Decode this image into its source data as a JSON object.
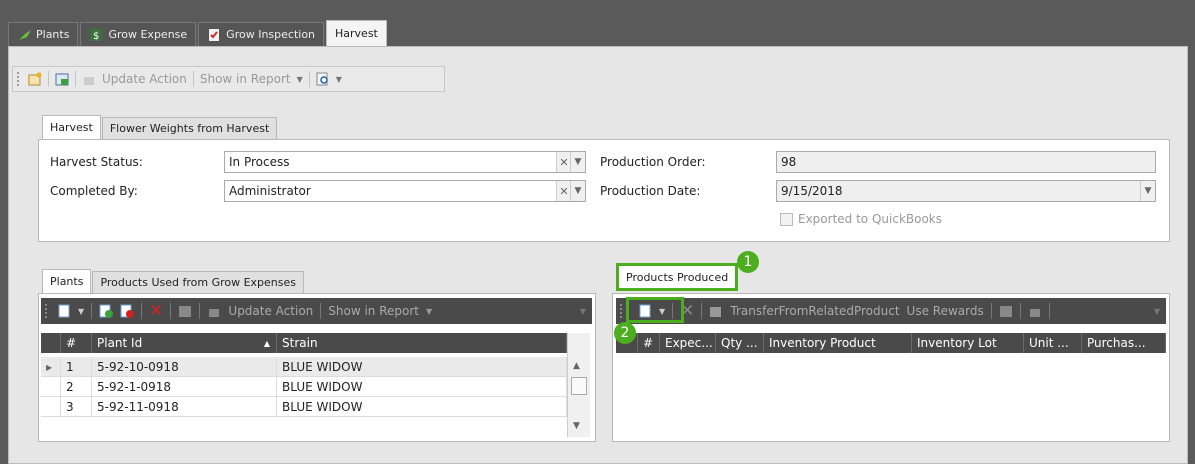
{
  "doc_tabs": [
    {
      "label": "Plants",
      "icon": "plant-icon"
    },
    {
      "label": "Grow Expense",
      "icon": "expense-icon"
    },
    {
      "label": "Grow Inspection",
      "icon": "inspection-icon"
    },
    {
      "label": "Harvest",
      "icon": ""
    }
  ],
  "main_toolbar": {
    "update_action": "Update Action",
    "show_in_report": "Show in Report"
  },
  "harvest_tabs": [
    "Harvest",
    "Flower Weights from Harvest"
  ],
  "form": {
    "harvest_status_label": "Harvest Status:",
    "harvest_status_value": "In Process",
    "completed_by_label": "Completed By:",
    "completed_by_value": "Administrator",
    "production_order_label": "Production Order:",
    "production_order_value": "98",
    "production_date_label": "Production Date:",
    "production_date_value": "9/15/2018",
    "exported_label": "Exported to QuickBooks"
  },
  "plants_tabs": [
    "Plants",
    "Products Used from Grow Expenses"
  ],
  "plants_toolbar": {
    "update_action": "Update Action",
    "show_in_report": "Show in Report"
  },
  "plants_grid": {
    "columns": [
      "#",
      "Plant Id",
      "Strain"
    ],
    "rows": [
      {
        "n": "1",
        "plant_id": "5-92-10-0918",
        "strain": "BLUE WIDOW"
      },
      {
        "n": "2",
        "plant_id": "5-92-1-0918",
        "strain": "BLUE WIDOW"
      },
      {
        "n": "3",
        "plant_id": "5-92-11-0918",
        "strain": "BLUE WIDOW"
      }
    ]
  },
  "products_tab": "Products Produced",
  "products_toolbar": {
    "transfer": "TransferFromRelatedProduct",
    "use_rewards": "Use Rewards"
  },
  "products_grid": {
    "columns": [
      "#",
      "Expec...",
      "Qty ...",
      "Inventory Product",
      "Inventory Lot",
      "Unit ...",
      "Purchas..."
    ]
  },
  "callouts": [
    "1",
    "2"
  ],
  "colors": {
    "accent": "#4cae1f",
    "delete": "#d32020"
  }
}
